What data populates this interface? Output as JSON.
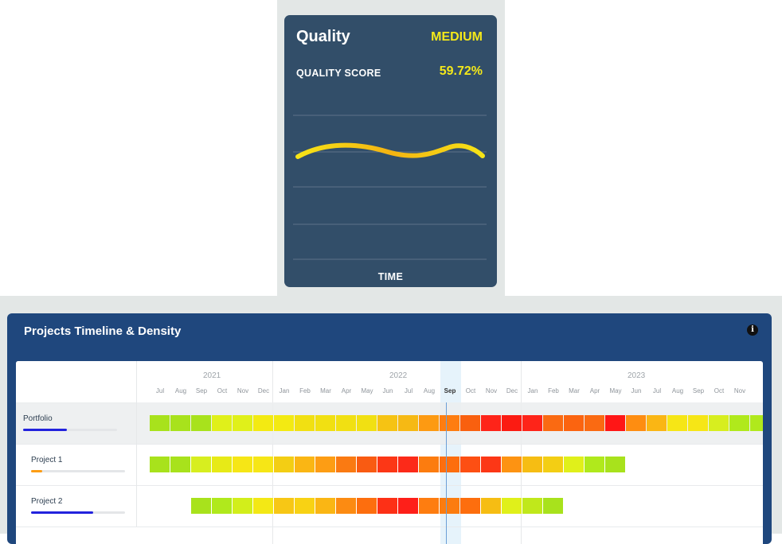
{
  "quality": {
    "title": "Quality",
    "level": "MEDIUM",
    "score_label": "QUALITY SCORE",
    "score_value": "59.72%",
    "x_axis_label": "TIME",
    "accent_color": "#f4e81a"
  },
  "timeline": {
    "title": "Projects Timeline & Density",
    "info_icon": "info-icon",
    "years": [
      "2021",
      "2022",
      "2023"
    ],
    "months": [
      "Jul",
      "Aug",
      "Sep",
      "Oct",
      "Nov",
      "Dec",
      "Jan",
      "Feb",
      "Mar",
      "Apr",
      "May",
      "Jun",
      "Jul",
      "Aug",
      "Sep",
      "Oct",
      "Nov",
      "Dec",
      "Jan",
      "Feb",
      "Mar",
      "Apr",
      "May",
      "Jun",
      "Jul",
      "Aug",
      "Sep",
      "Oct",
      "Nov"
    ],
    "current_month_index": 14,
    "rows": [
      {
        "name": "Portfolio",
        "progress": 0.47,
        "progress_color": "#2222dd",
        "start_index": 0,
        "cells": [
          "#a8e21c",
          "#a8e21c",
          "#a8e21c",
          "#e0f01a",
          "#e0f01a",
          "#f3ea12",
          "#f3ea12",
          "#f1e012",
          "#f1e012",
          "#f1e012",
          "#f1e012",
          "#f6c313",
          "#f6b914",
          "#fd9a12",
          "#fe7d10",
          "#f9600f",
          "#fe2419",
          "#fb1b12",
          "#fe2419",
          "#fa6a12",
          "#fb6410",
          "#fa6a12",
          "#ff1616",
          "#fe8d11",
          "#fab614",
          "#f6e616",
          "#f6e616",
          "#d7ee1f",
          "#b0e91c",
          "#b0e91c"
        ]
      },
      {
        "name": "Project 1",
        "progress": 0.12,
        "progress_color": "#fd9d14",
        "start_index": 0,
        "cells": [
          "#a8e21c",
          "#a8e21c",
          "#d7ee1f",
          "#e7ea17",
          "#f6e616",
          "#f6e616",
          "#f3ce14",
          "#fab614",
          "#fd9d14",
          "#fa7a12",
          "#f95b12",
          "#fc3716",
          "#fc2a19",
          "#fc7c0f",
          "#fd6e0e",
          "#fd4f13",
          "#fc3716",
          "#fd9312",
          "#f6bd13",
          "#f3ce14",
          "#e0f01a",
          "#b0e91c",
          "#a8e21c"
        ]
      },
      {
        "name": "Project 2",
        "progress": 0.66,
        "progress_color": "#2222dd",
        "start_index": 2,
        "cells": [
          "#a8e21c",
          "#b0e91c",
          "#d2ee1b",
          "#f3e815",
          "#f7c715",
          "#f8d214",
          "#fab614",
          "#fc8b12",
          "#fd6e0e",
          "#fd3016",
          "#fe1f19",
          "#fe7d10",
          "#fc7c0f",
          "#fd6e0e",
          "#f6bd13",
          "#e0f01a",
          "#c0e81b",
          "#a8e21c"
        ]
      }
    ]
  }
}
